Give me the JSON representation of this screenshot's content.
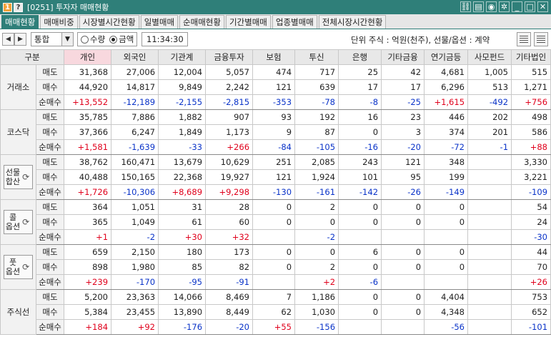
{
  "window": {
    "badge_1": "1",
    "badge_2": "?",
    "title": "[0251] 투자자 매매현황",
    "icons": [
      "link-icon",
      "copy-icon",
      "camera-icon",
      "gear-icon",
      "minimize-icon",
      "maximize-icon",
      "close-icon"
    ]
  },
  "tabs": [
    {
      "label": "매매현황",
      "active": true
    },
    {
      "label": "매매비중",
      "active": false
    },
    {
      "label": "시장별시간현황",
      "active": false
    },
    {
      "label": "일별매매",
      "active": false
    },
    {
      "label": "순매매현황",
      "active": false
    },
    {
      "label": "기간별매매",
      "active": false
    },
    {
      "label": "업종별매매",
      "active": false
    },
    {
      "label": "전체시장시간현황",
      "active": false
    }
  ],
  "toolbar": {
    "market_select": "통합",
    "radio_qty": "수량",
    "radio_amount": "금액",
    "selected": "금액",
    "time": "11:34:30",
    "unit_text": "단위 주식 : 억원(천주), 선물/옵션 : 계약"
  },
  "table": {
    "headers": [
      "구분",
      "",
      "개인",
      "외국인",
      "기관계",
      "금융투자",
      "보험",
      "투신",
      "은행",
      "기타금융",
      "연기금등",
      "사모펀드",
      "기타법인"
    ],
    "highlight_header": "개인",
    "colors": {
      "positive": "#e0001b",
      "negative": "#0a33c8"
    },
    "groups": [
      {
        "name_lines": [
          "거래소"
        ],
        "boxed": false,
        "rows": [
          {
            "label": "매도",
            "values": [
              "31,368",
              "27,006",
              "12,004",
              "5,057",
              "474",
              "717",
              "25",
              "42",
              "4,681",
              "1,005",
              "515"
            ]
          },
          {
            "label": "매수",
            "values": [
              "44,920",
              "14,817",
              "9,849",
              "2,242",
              "121",
              "639",
              "17",
              "17",
              "6,296",
              "513",
              "1,271"
            ]
          },
          {
            "label": "순매수",
            "values": [
              "+13,552",
              "-12,189",
              "-2,155",
              "-2,815",
              "-353",
              "-78",
              "-8",
              "-25",
              "+1,615",
              "-492",
              "+756"
            ]
          }
        ]
      },
      {
        "name_lines": [
          "코스닥"
        ],
        "boxed": false,
        "rows": [
          {
            "label": "매도",
            "values": [
              "35,785",
              "7,886",
              "1,882",
              "907",
              "93",
              "192",
              "16",
              "23",
              "446",
              "202",
              "498"
            ]
          },
          {
            "label": "매수",
            "values": [
              "37,366",
              "6,247",
              "1,849",
              "1,173",
              "9",
              "87",
              "0",
              "3",
              "374",
              "201",
              "586"
            ]
          },
          {
            "label": "순매수",
            "values": [
              "+1,581",
              "-1,639",
              "-33",
              "+266",
              "-84",
              "-105",
              "-16",
              "-20",
              "-72",
              "-1",
              "+88"
            ]
          }
        ]
      },
      {
        "name_lines": [
          "선물",
          "합산"
        ],
        "boxed": true,
        "rows": [
          {
            "label": "매도",
            "values": [
              "38,762",
              "160,471",
              "13,679",
              "10,629",
              "251",
              "2,085",
              "243",
              "121",
              "348",
              "",
              "3,330"
            ]
          },
          {
            "label": "매수",
            "values": [
              "40,488",
              "150,165",
              "22,368",
              "19,927",
              "121",
              "1,924",
              "101",
              "95",
              "199",
              "",
              "3,221"
            ]
          },
          {
            "label": "순매수",
            "values": [
              "+1,726",
              "-10,306",
              "+8,689",
              "+9,298",
              "-130",
              "-161",
              "-142",
              "-26",
              "-149",
              "",
              "-109"
            ]
          }
        ]
      },
      {
        "name_lines": [
          "콜",
          "옵션"
        ],
        "boxed": true,
        "rows": [
          {
            "label": "매도",
            "values": [
              "364",
              "1,051",
              "31",
              "28",
              "0",
              "2",
              "0",
              "0",
              "0",
              "",
              "54"
            ]
          },
          {
            "label": "매수",
            "values": [
              "365",
              "1,049",
              "61",
              "60",
              "0",
              "0",
              "0",
              "0",
              "0",
              "",
              "24"
            ]
          },
          {
            "label": "순매수",
            "values": [
              "+1",
              "-2",
              "+30",
              "+32",
              "",
              "-2",
              "",
              "",
              "",
              "",
              "-30"
            ]
          }
        ]
      },
      {
        "name_lines": [
          "풋",
          "옵션"
        ],
        "boxed": true,
        "rows": [
          {
            "label": "매도",
            "values": [
              "659",
              "2,150",
              "180",
              "173",
              "0",
              "0",
              "6",
              "0",
              "0",
              "",
              "44"
            ]
          },
          {
            "label": "매수",
            "values": [
              "898",
              "1,980",
              "85",
              "82",
              "0",
              "2",
              "0",
              "0",
              "0",
              "",
              "70"
            ]
          },
          {
            "label": "순매수",
            "values": [
              "+239",
              "-170",
              "-95",
              "-91",
              "",
              "+2",
              "-6",
              "",
              "",
              "",
              "+26"
            ]
          }
        ]
      },
      {
        "name_lines": [
          "주식선"
        ],
        "boxed": false,
        "rows": [
          {
            "label": "매도",
            "values": [
              "5,200",
              "23,363",
              "14,066",
              "8,469",
              "7",
              "1,186",
              "0",
              "0",
              "4,404",
              "",
              "753"
            ]
          },
          {
            "label": "매수",
            "values": [
              "5,384",
              "23,455",
              "13,890",
              "8,449",
              "62",
              "1,030",
              "0",
              "0",
              "4,348",
              "",
              "652"
            ]
          },
          {
            "label": "순매수",
            "values": [
              "+184",
              "+92",
              "-176",
              "-20",
              "+55",
              "-156",
              "",
              "",
              "-56",
              "",
              "-101"
            ]
          }
        ]
      }
    ]
  }
}
